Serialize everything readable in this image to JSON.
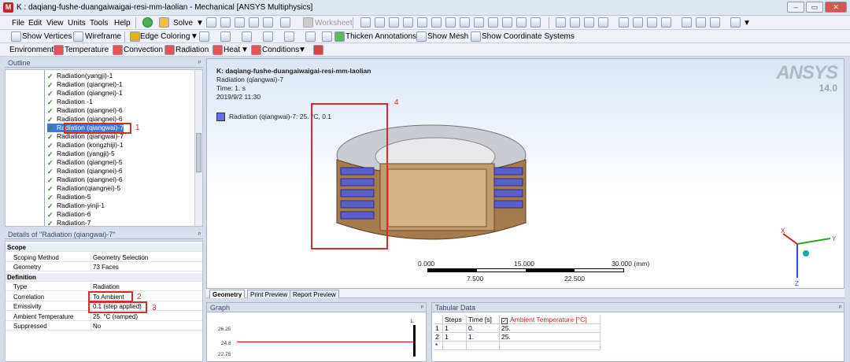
{
  "window": {
    "title": "K : daqiang-fushe-duangaiwaigai-resi-mm-laolian - Mechanical [ANSYS Multiphysics]",
    "app_icon": "M"
  },
  "menu": [
    "File",
    "Edit",
    "View",
    "Units",
    "Tools",
    "Help"
  ],
  "toolbar1": {
    "solve": "Solve",
    "worksheet": "Worksheet"
  },
  "toolbar2": {
    "show_vertices": "Show Vertices",
    "wireframe": "Wireframe",
    "edge_coloring": "Edge Coloring",
    "thicken": "Thicken Annotations",
    "show_mesh": "Show Mesh",
    "show_coord": "Show Coordinate Systems"
  },
  "toolbar3": {
    "environment": "Environment",
    "temperature": "Temperature",
    "convection": "Convection",
    "radiation": "Radiation",
    "heat": "Heat",
    "conditions": "Conditions"
  },
  "outline": {
    "title": "Outline",
    "items": [
      "Radiation(yangji)-1",
      "Radiation (qiangnei)-1",
      "Radiation (qiangnei)-1",
      "Radiation -1",
      "Radiation (qiangnei)-6",
      "Radiation (qiangnei)-6",
      "Radiation (qiangwai)-7",
      "Radiation (qiangwai)-7",
      "Radiation (kongzhiji)-1",
      "Radiation (yangji)-5",
      "Radiation (qiangnei)-5",
      "Radiation (qiangnei)-6",
      "Radiation (qiangnei)-6",
      "Radiation(qiangnei)-5",
      "Radiation-5",
      "Radiation-yinji-1",
      "Radiation-6",
      "Radiation-7"
    ],
    "selected_index": 6
  },
  "details": {
    "title": "Details of \"Radiation (qiangwai)-7\"",
    "rows": [
      {
        "k": "Scope",
        "v": "",
        "group": true
      },
      {
        "k": "Scoping Method",
        "v": "Geometry Selection"
      },
      {
        "k": "Geometry",
        "v": "73 Faces"
      },
      {
        "k": "Definition",
        "v": "",
        "group": true
      },
      {
        "k": "Type",
        "v": "Radiation"
      },
      {
        "k": "Correlation",
        "v": "To Ambient"
      },
      {
        "k": "Emissivity",
        "v": "0.1    (step applied)"
      },
      {
        "k": "Ambient Temperature",
        "v": "25. °C  (ramped)"
      },
      {
        "k": "Suppressed",
        "v": "No"
      }
    ]
  },
  "viewport": {
    "line1": "K: daqiang-fushe-duangaiwaigai-resi-mm-laolian",
    "line2": "Radiation (qiangwai)-7",
    "line3": "Time: 1. s",
    "line4": "2019/9/2 11:30",
    "legend": "Radiation (qiangwai)-7: 25. °C, 0.1",
    "logo": "ANSYS",
    "version": "14.0",
    "scale_top": [
      "0.000",
      "15.000",
      "30.000 (mm)"
    ],
    "scale_bottom": [
      "7.500",
      "22.500"
    ]
  },
  "annotations": [
    "1",
    "2",
    "3",
    "4"
  ],
  "view_tabs": [
    "Geometry",
    "Print Preview",
    "Report Preview"
  ],
  "graph": {
    "title": "Graph",
    "yticks": [
      "26.25",
      "24.8",
      "22.75"
    ],
    "xtick": "1."
  },
  "tabular": {
    "title": "Tabular Data",
    "headers": [
      "Steps",
      "Time [s]",
      "Ambient Temperature [°C]"
    ],
    "rows": [
      [
        "1",
        "1",
        "0.",
        "25."
      ],
      [
        "2",
        "1",
        "1.",
        "25."
      ],
      [
        "*",
        "",
        "",
        ""
      ]
    ]
  },
  "colors": {
    "accent": "#3d78d8",
    "annotation": "#d62c2c"
  }
}
